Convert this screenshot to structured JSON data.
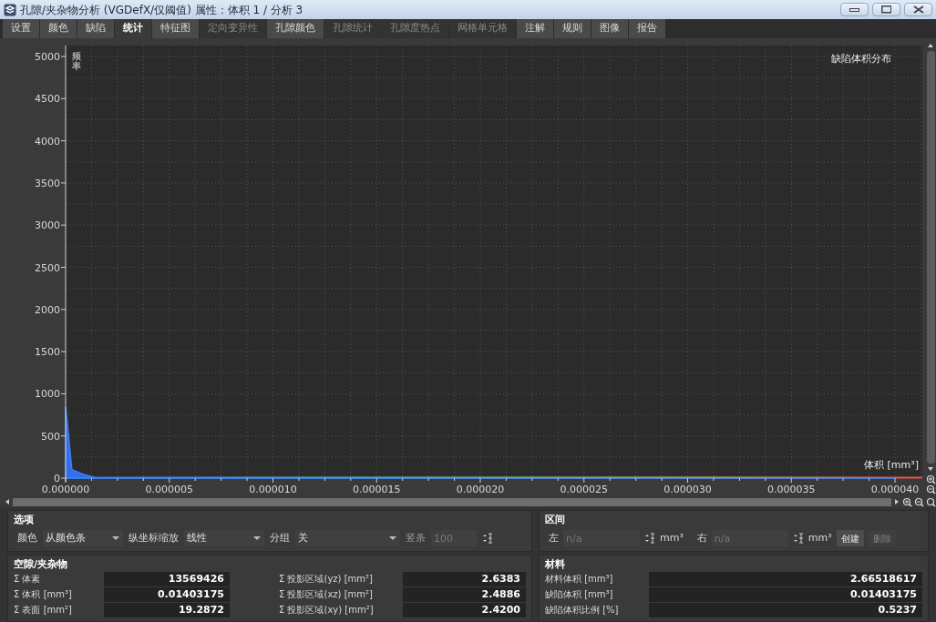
{
  "window": {
    "title": "孔隙/夹杂物分析 (VGDefX/仅阈值) 属性：体积 1 / 分析 3"
  },
  "tabs": [
    {
      "label": "设置",
      "selected": false,
      "disabled": false
    },
    {
      "label": "颜色",
      "selected": false,
      "disabled": false
    },
    {
      "label": "缺陷",
      "selected": false,
      "disabled": false
    },
    {
      "label": "统计",
      "selected": true,
      "disabled": false
    },
    {
      "label": "特征图",
      "selected": false,
      "disabled": false
    },
    {
      "label": "定向变异性",
      "selected": false,
      "disabled": true
    },
    {
      "label": "孔隙颜色",
      "selected": false,
      "disabled": false
    },
    {
      "label": "孔隙统计",
      "selected": false,
      "disabled": true
    },
    {
      "label": "孔隙度热点",
      "selected": false,
      "disabled": true
    },
    {
      "label": "网格单元格",
      "selected": false,
      "disabled": true
    },
    {
      "label": "注解",
      "selected": false,
      "disabled": false
    },
    {
      "label": "规则",
      "selected": false,
      "disabled": false
    },
    {
      "label": "图像",
      "selected": false,
      "disabled": false
    },
    {
      "label": "报告",
      "selected": false,
      "disabled": false
    }
  ],
  "chart": {
    "chart_data": {
      "type": "area",
      "title": "缺陷体积分布",
      "xlabel": "体积 [mm³]",
      "ylabel": "频率",
      "x": [
        0,
        3e-07,
        8e-07,
        1.5e-06,
        3e-06,
        1e-05,
        4e-05
      ],
      "values": [
        850,
        100,
        50,
        0,
        0,
        0,
        0
      ],
      "grid": true,
      "xlim": [
        0,
        4e-05
      ],
      "ylim": [
        0,
        5000
      ],
      "xticks": [
        {
          "value": 0,
          "label": "0.000000"
        },
        {
          "value": 5e-06,
          "label": "0.000005"
        },
        {
          "value": 1e-05,
          "label": "0.000010"
        },
        {
          "value": 1.5e-05,
          "label": "0.000015"
        },
        {
          "value": 2e-05,
          "label": "0.000020"
        },
        {
          "value": 2.5e-05,
          "label": "0.000025"
        },
        {
          "value": 3e-05,
          "label": "0.000030"
        },
        {
          "value": 3.5e-05,
          "label": "0.000035"
        },
        {
          "value": 4e-05,
          "label": "0.000040"
        }
      ],
      "yticks": [
        0,
        500,
        1000,
        1500,
        2000,
        2500,
        3000,
        3500,
        4000,
        4500,
        5000
      ]
    }
  },
  "options": {
    "title": "选项",
    "fields": [
      {
        "label": "颜色",
        "value": "从颜色条"
      },
      {
        "label": "纵坐标缩放",
        "value": "线性"
      },
      {
        "label": "分组",
        "value": "关"
      }
    ],
    "bins": {
      "label": "竖条",
      "value": "100",
      "disabled": true
    }
  },
  "interval": {
    "title": "区间",
    "fields": [
      {
        "label": "左",
        "placeholder": "n/a",
        "unit": "mm³"
      },
      {
        "label": "右",
        "placeholder": "n/a",
        "unit": "mm³"
      }
    ],
    "buttons": [
      {
        "label": "创建",
        "disabled": false
      },
      {
        "label": "删除",
        "disabled": true
      }
    ]
  },
  "voids": {
    "title": "空隙/夹杂物",
    "rows": [
      {
        "label": "Σ 体素",
        "value": "13569426"
      },
      {
        "label": "Σ 投影区域(yz) [mm²]",
        "value": "2.6383"
      },
      {
        "label": "Σ 体积 [mm³]",
        "value": "0.01403175"
      },
      {
        "label": "Σ 投影区域(xz) [mm²]",
        "value": "2.4886"
      },
      {
        "label": "Σ 表面 [mm²]",
        "value": "19.2872"
      },
      {
        "label": "Σ 投影区域(xy) [mm²]",
        "value": "2.4200"
      }
    ]
  },
  "material": {
    "title": "材料",
    "rows": [
      {
        "label": "材料体积 [mm³]",
        "value": "2.66518617"
      },
      {
        "label": "缺陷体积 [mm³]",
        "value": "0.01403175"
      },
      {
        "label": "缺陷体积比例 [%]",
        "value": "0.5237"
      }
    ]
  }
}
